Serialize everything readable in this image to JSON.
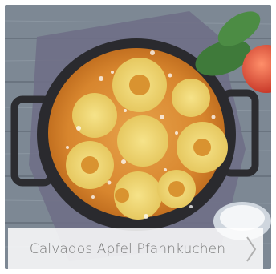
{
  "recipe_card": {
    "title": "Calvados Apfel Pfannkuchen",
    "image_icon": "recipe-photo",
    "next_icon": "chevron-right-icon"
  },
  "colors": {
    "caption_bg": "#ffffffd9",
    "caption_text": "#7a7a7a",
    "chevron": "#b0b0b0"
  }
}
